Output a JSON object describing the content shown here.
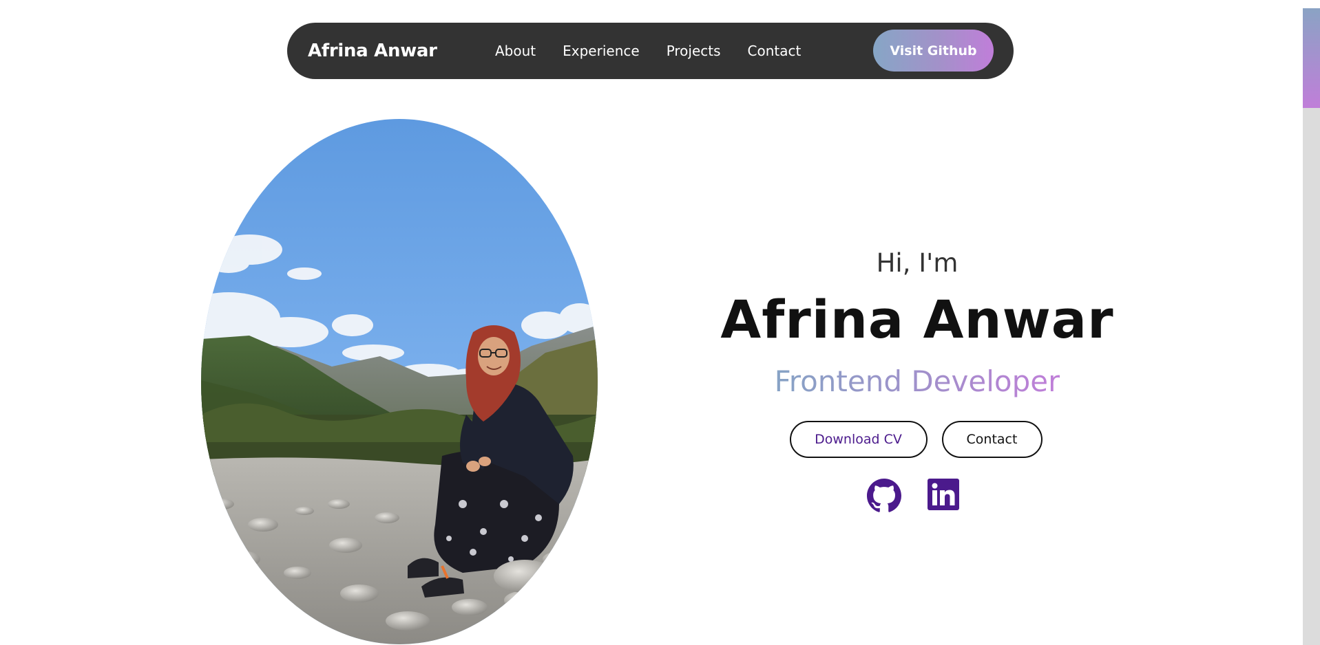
{
  "nav": {
    "brand": "Afrina Anwar",
    "links": [
      {
        "label": "About"
      },
      {
        "label": "Experience"
      },
      {
        "label": "Projects"
      },
      {
        "label": "Contact"
      }
    ],
    "cta_label": "Visit Github"
  },
  "hero": {
    "greeting": "Hi, I'm",
    "name": "Afrina Anwar",
    "role": "Frontend Developer",
    "download_label": "Download CV",
    "contact_label": "Contact"
  },
  "profile_photo": {
    "alt": "Profile picture"
  },
  "social": [
    {
      "icon": "github-icon"
    },
    {
      "icon": "linkedin-icon"
    }
  ],
  "colors": {
    "navbar": "#333333",
    "accent_start": "#86a6c6",
    "accent_end": "#c07ed9",
    "icon_purple": "#4b1a8c",
    "scrollbar_track": "#dcdcdc"
  }
}
